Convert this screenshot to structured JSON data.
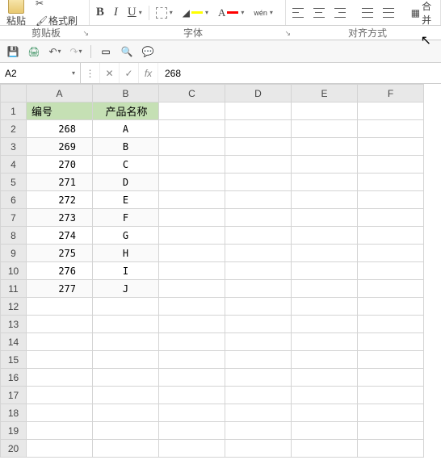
{
  "ribbon": {
    "paste_label": "粘贴",
    "format_painter_label": "格式刷",
    "bold": "B",
    "italic": "I",
    "underline": "U",
    "pinyin": "wén",
    "merge_label": "合并",
    "groups": {
      "clipboard": "剪贴板",
      "font": "字体",
      "alignment": "对齐方式"
    }
  },
  "qat": {},
  "formula_bar": {
    "name_box": "A2",
    "cancel": "✕",
    "confirm": "✓",
    "fx": "fx",
    "value": "268"
  },
  "sheet": {
    "columns": [
      "A",
      "B",
      "C",
      "D",
      "E",
      "F"
    ],
    "row_count": 20,
    "headers": {
      "A": "编号",
      "B": "产品名称"
    },
    "chart_data": {
      "type": "table",
      "columns": [
        "编号",
        "产品名称"
      ],
      "rows": [
        [
          268,
          "A"
        ],
        [
          269,
          "B"
        ],
        [
          270,
          "C"
        ],
        [
          271,
          "D"
        ],
        [
          272,
          "E"
        ],
        [
          273,
          "F"
        ],
        [
          274,
          "G"
        ],
        [
          275,
          "H"
        ],
        [
          276,
          "I"
        ],
        [
          277,
          "J"
        ]
      ]
    }
  }
}
